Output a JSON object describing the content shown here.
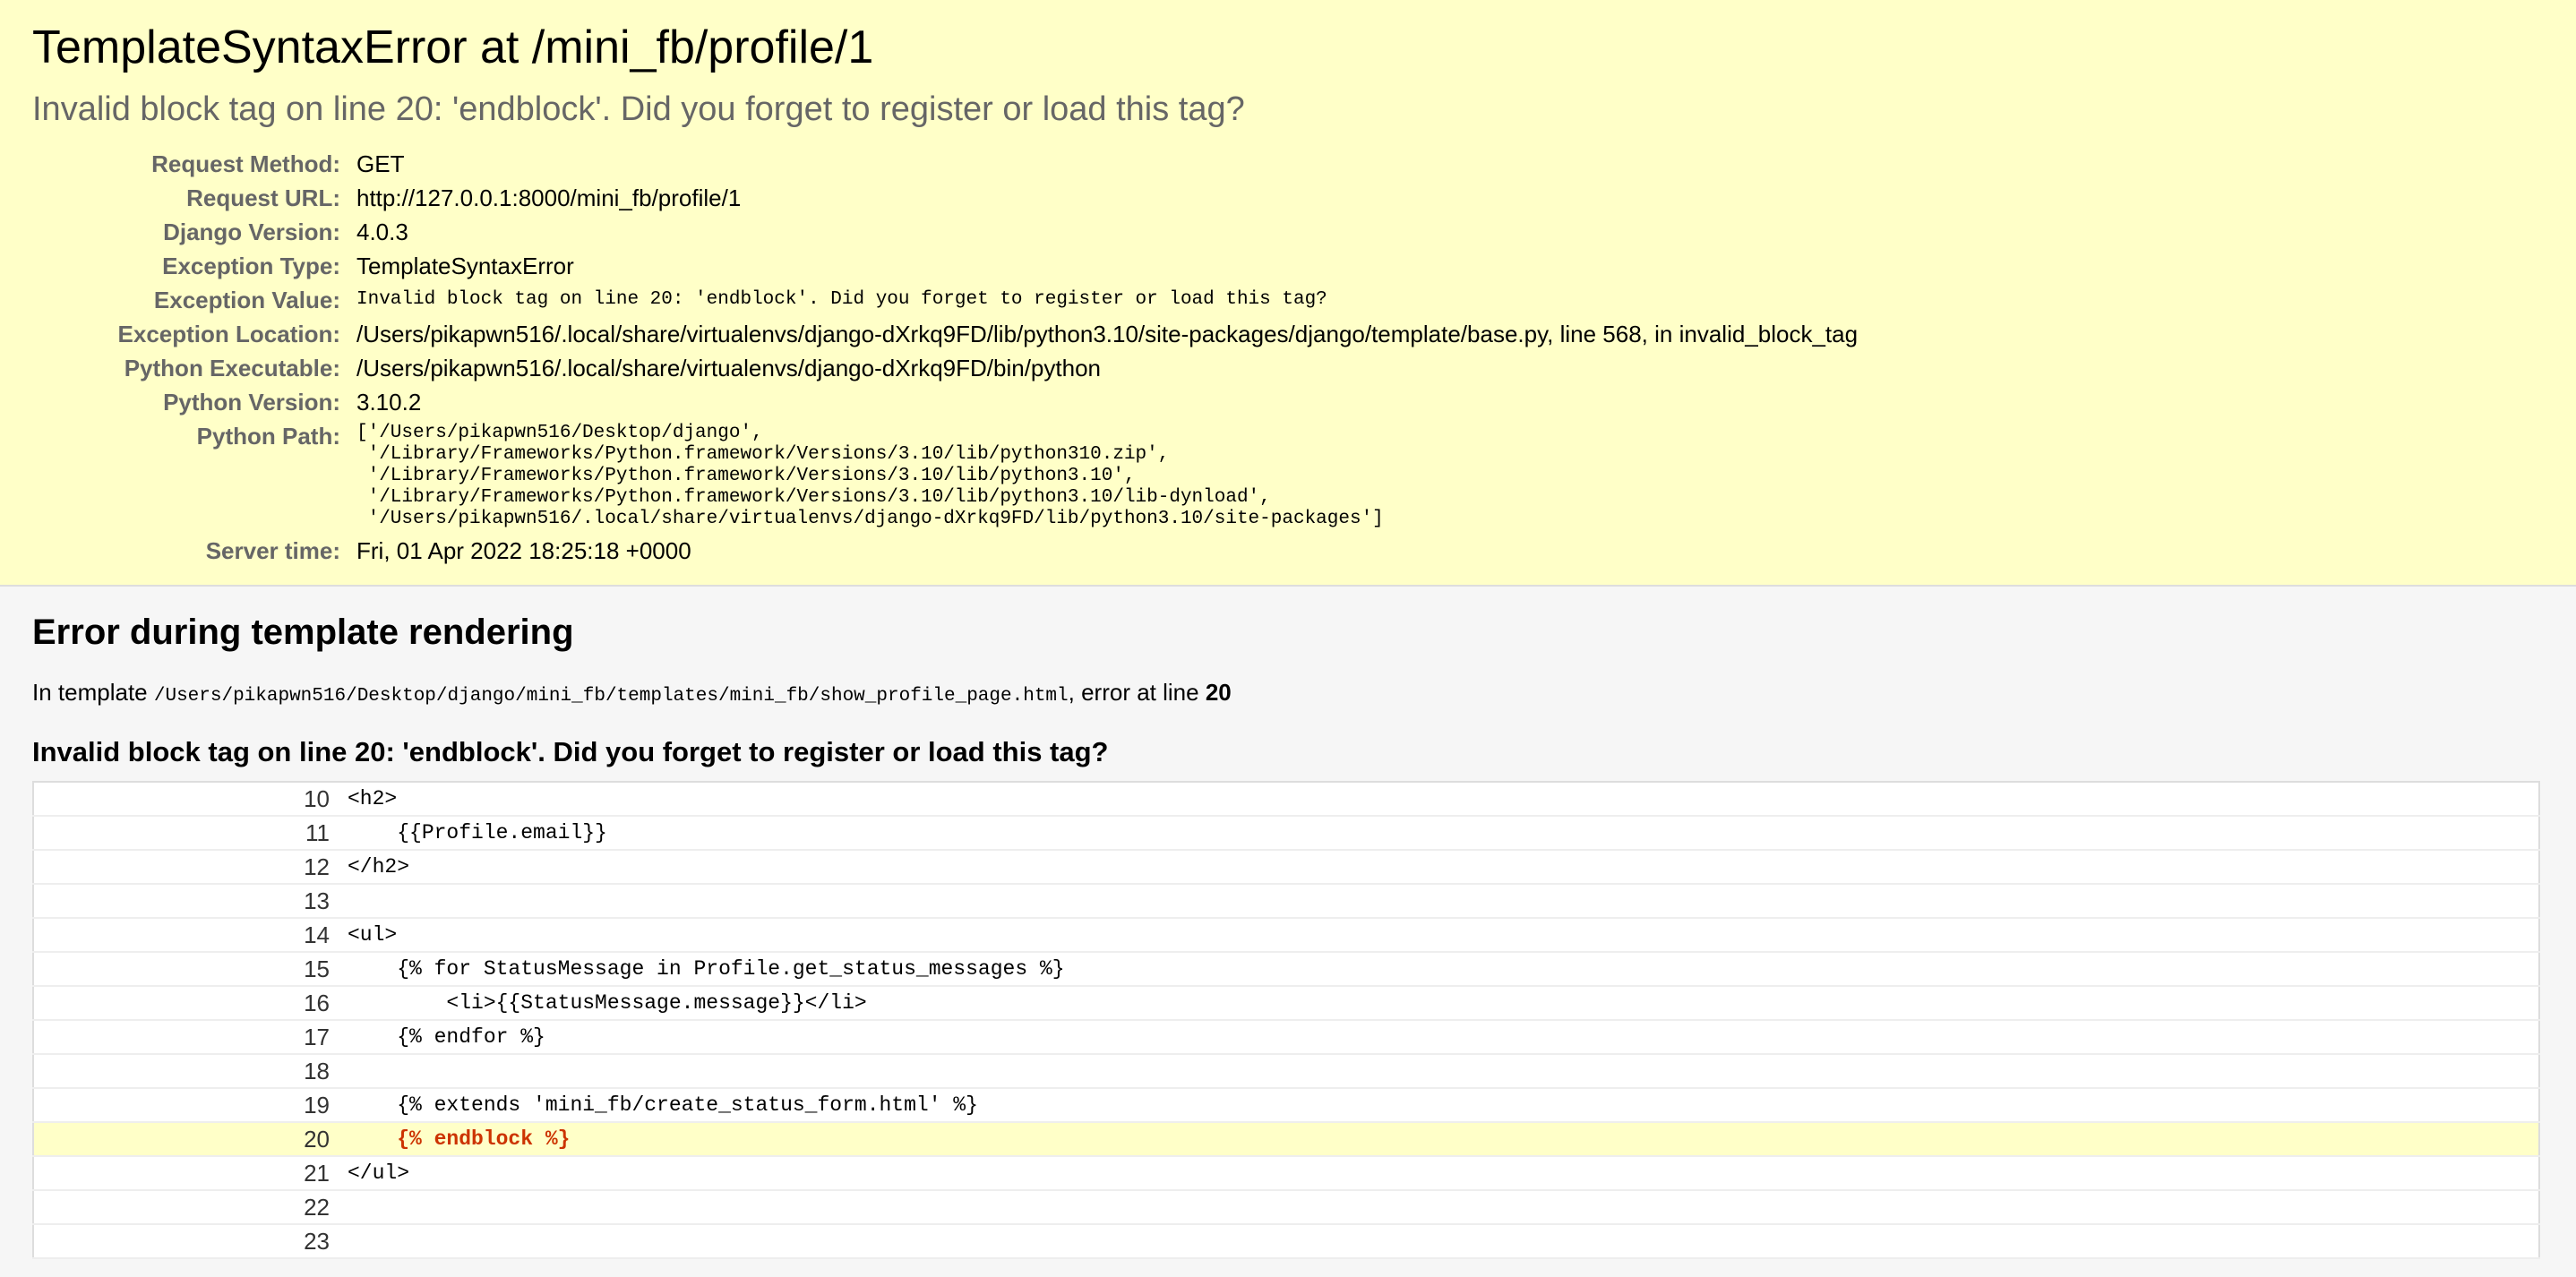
{
  "summary": {
    "title": "TemplateSyntaxError at /mini_fb/profile/1",
    "message": "Invalid block tag on line 20: 'endblock'. Did you forget to register or load this tag?",
    "meta": [
      {
        "label": "Request Method:",
        "value": "GET"
      },
      {
        "label": "Request URL:",
        "value": "http://127.0.0.1:8000/mini_fb/profile/1"
      },
      {
        "label": "Django Version:",
        "value": "4.0.3"
      },
      {
        "label": "Exception Type:",
        "value": "TemplateSyntaxError"
      },
      {
        "label": "Exception Value:",
        "value": "Invalid block tag on line 20: 'endblock'. Did you forget to register or load this tag?"
      },
      {
        "label": "Exception Location:",
        "value": "/Users/pikapwn516/.local/share/virtualenvs/django-dXrkq9FD/lib/python3.10/site-packages/django/template/base.py, line 568, in invalid_block_tag"
      },
      {
        "label": "Python Executable:",
        "value": "/Users/pikapwn516/.local/share/virtualenvs/django-dXrkq9FD/bin/python"
      },
      {
        "label": "Python Version:",
        "value": "3.10.2"
      },
      {
        "label": "Python Path:",
        "value": "['/Users/pikapwn516/Desktop/django',\n '/Library/Frameworks/Python.framework/Versions/3.10/lib/python310.zip',\n '/Library/Frameworks/Python.framework/Versions/3.10/lib/python3.10',\n '/Library/Frameworks/Python.framework/Versions/3.10/lib/python3.10/lib-dynload',\n '/Users/pikapwn516/.local/share/virtualenvs/django-dXrkq9FD/lib/python3.10/site-packages']"
      },
      {
        "label": "Server time:",
        "value": "Fri, 01 Apr 2022 18:25:18 +0000"
      }
    ]
  },
  "template": {
    "heading": "Error during template rendering",
    "in_template_prefix": "In template ",
    "template_path": "/Users/pikapwn516/Desktop/django/mini_fb/templates/mini_fb/show_profile_page.html",
    "error_at_text": ", error at line ",
    "error_line": "20",
    "message": "Invalid block tag on line 20: 'endblock'. Did you forget to register or load this tag?",
    "lines": [
      {
        "num": "10",
        "code": "<h2>"
      },
      {
        "num": "11",
        "code": "    {{Profile.email}}"
      },
      {
        "num": "12",
        "code": "</h2>"
      },
      {
        "num": "13",
        "code": ""
      },
      {
        "num": "14",
        "code": "<ul>"
      },
      {
        "num": "15",
        "code": "    {% for StatusMessage in Profile.get_status_messages %}"
      },
      {
        "num": "16",
        "code": "        <li>{{StatusMessage.message}}</li>"
      },
      {
        "num": "17",
        "code": "    {% endfor %}"
      },
      {
        "num": "18",
        "code": ""
      },
      {
        "num": "19",
        "code": "    {% extends 'mini_fb/create_status_form.html' %}"
      },
      {
        "num": "20",
        "code": "    {% endblock %}"
      },
      {
        "num": "21",
        "code": "</ul>"
      },
      {
        "num": "22",
        "code": ""
      },
      {
        "num": "23",
        "code": ""
      }
    ]
  }
}
